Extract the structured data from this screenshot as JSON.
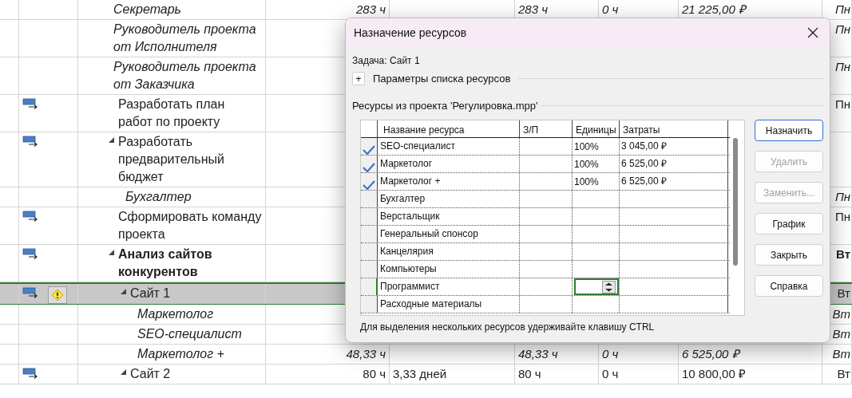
{
  "grid": {
    "rows": [
      {
        "kind": "assignment",
        "name": "Секретарь",
        "selected": false,
        "indicator": false,
        "warning": false,
        "cells": {
          "column_4": "283 ч",
          "column_6": "283 ч",
          "column_7": "0 ч",
          "column_8": "21 225,00 ₽",
          "column_9": "Пн"
        }
      },
      {
        "kind": "assignment",
        "name": "Руководитель проекта от Исполнителя",
        "selected": false,
        "indicator": false,
        "warning": false,
        "cells": {
          "column_9": "Пн"
        }
      },
      {
        "kind": "assignment",
        "name": "Руководитель проекта от Заказчика",
        "selected": false,
        "indicator": false,
        "warning": false,
        "cells": {
          "column_9": "Пн"
        }
      },
      {
        "kind": "task",
        "name": "Разработать план работ по проекту",
        "selected": false,
        "indicator": true,
        "warning": false,
        "expanded": false,
        "cells": {
          "column_9": "Пн"
        }
      },
      {
        "kind": "task",
        "name": "Разработать предварительный бюджет",
        "selected": false,
        "indicator": true,
        "warning": false,
        "expanded": true,
        "cells": {},
        "children": [
          {
            "kind": "assignment",
            "name": "Бухгалтер",
            "selected": false,
            "indicator": false,
            "warning": false,
            "cells": {
              "column_9": "Пн"
            }
          }
        ]
      },
      {
        "kind": "task",
        "name": "Сформировать команду проекта",
        "selected": false,
        "indicator": true,
        "warning": false,
        "expanded": false,
        "cells": {
          "column_9": "Пн"
        }
      },
      {
        "kind": "summary",
        "name": "Анализ сайтов конкурентов",
        "selected": false,
        "indicator": true,
        "warning": false,
        "expanded": true,
        "cells": {
          "column_9": "Вт"
        },
        "children": [
          {
            "kind": "task",
            "name": "Сайт 1",
            "selected": true,
            "indicator": true,
            "warning": true,
            "expanded": true,
            "cells": {
              "column_9": "Вт"
            },
            "children": [
              {
                "kind": "assignment",
                "name": "Маркетолог",
                "selected": false,
                "indicator": false,
                "warning": false,
                "cells": {
                  "column_9": "Вт"
                }
              },
              {
                "kind": "assignment",
                "name": "SEO-специалист",
                "selected": false,
                "indicator": false,
                "warning": false,
                "cells": {
                  "column_9": "Вт"
                }
              },
              {
                "kind": "assignment",
                "name": "Маркетолог +",
                "selected": false,
                "indicator": false,
                "warning": false,
                "cells": {
                  "column_4": "48,33 ч",
                  "column_6": "48,33 ч",
                  "column_7": "0 ч",
                  "column_8": "6 525,00 ₽",
                  "column_9": "Вт"
                }
              }
            ]
          },
          {
            "kind": "task",
            "name": "Сайт 2",
            "selected": false,
            "indicator": true,
            "warning": false,
            "expanded": true,
            "cells": {
              "column_4": "80 ч",
              "column_5": "3,33 дней",
              "column_6": "80 ч",
              "column_7": "0 ч",
              "column_8": "10 800,00 ₽",
              "column_9": "Вт"
            }
          }
        ]
      }
    ]
  },
  "dialog": {
    "title": "Назначение ресурсов",
    "task_label": "Задача: Сайт 1",
    "options_toggle": "+",
    "options_label": "Параметры списка ресурсов",
    "resources_label": "Ресурсы из проекта 'Регулировка.mpp'",
    "table": {
      "columns": [
        "Название ресурса",
        "З/П",
        "Единицы",
        "Затраты"
      ],
      "rows": [
        {
          "name": "SEO-специалист",
          "assigned": true,
          "selected": false,
          "units": "100%",
          "cost": "3 045,00 ₽"
        },
        {
          "name": "Маркетолог",
          "assigned": true,
          "selected": false,
          "units": "100%",
          "cost": "6 525,00 ₽"
        },
        {
          "name": "Маркетолог +",
          "assigned": true,
          "selected": false,
          "units": "100%",
          "cost": "6 525,00 ₽"
        },
        {
          "name": "Бухгалтер",
          "assigned": false,
          "selected": false
        },
        {
          "name": "Верстальщик",
          "assigned": false,
          "selected": false
        },
        {
          "name": "Генеральный спонсор",
          "assigned": false,
          "selected": false
        },
        {
          "name": "Канцелярия",
          "assigned": false,
          "selected": false
        },
        {
          "name": "Компьютеры",
          "assigned": false,
          "selected": false
        },
        {
          "name": "Программист",
          "assigned": false,
          "selected": true
        },
        {
          "name": "Расходные материалы",
          "assigned": false,
          "selected": false
        }
      ]
    },
    "buttons": [
      {
        "label": "Назначить",
        "disabled": false,
        "focused": true
      },
      {
        "label": "Удалить",
        "disabled": true,
        "focused": false
      },
      {
        "label": "Заменить...",
        "disabled": true,
        "focused": false
      },
      {
        "label": "График",
        "disabled": false,
        "focused": false
      },
      {
        "label": "Закрыть",
        "disabled": false,
        "focused": false
      },
      {
        "label": "Справка",
        "disabled": false,
        "focused": false
      }
    ],
    "hint": "Для выделения нескольких ресурсов удерживайте клавишу CTRL"
  }
}
